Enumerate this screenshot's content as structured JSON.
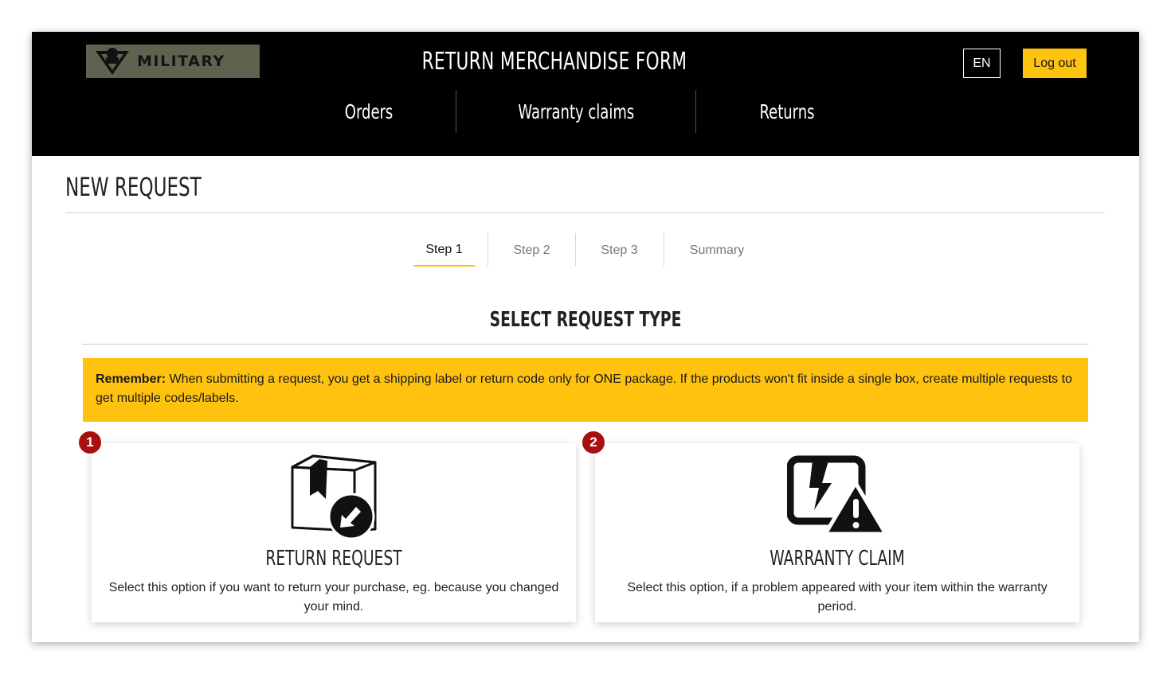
{
  "header": {
    "logo_text": "MILITARY",
    "app_title": "RETURN MERCHANDISE FORM",
    "language": "EN",
    "logout_label": "Log out",
    "nav": [
      "Orders",
      "Warranty claims",
      "Returns"
    ]
  },
  "page": {
    "title": "NEW REQUEST"
  },
  "steps": [
    "Step 1",
    "Step 2",
    "Step 3",
    "Summary"
  ],
  "active_step": "Step 1",
  "section": {
    "title": "SELECT REQUEST TYPE"
  },
  "notice": {
    "label": "Remember:",
    "text": " When submitting a request, you get a shipping label or return code only for ONE package. If the products won't fit inside a single box, create multiple requests to get multiple codes/labels."
  },
  "options": [
    {
      "number": "1",
      "icon": "package-return-icon",
      "title": "RETURN REQUEST",
      "description": "Select this option if you want to return your purchase, eg. because you changed your mind."
    },
    {
      "number": "2",
      "icon": "broken-device-warning-icon",
      "title": "WARRANTY CLAIM",
      "description": "Select this option, if a problem appeared with your item within the warranty period."
    }
  ],
  "colors": {
    "accent": "#fec20f",
    "header_bg": "#000000",
    "badge": "#a80f0f",
    "logo_bg": "#5f624f"
  }
}
